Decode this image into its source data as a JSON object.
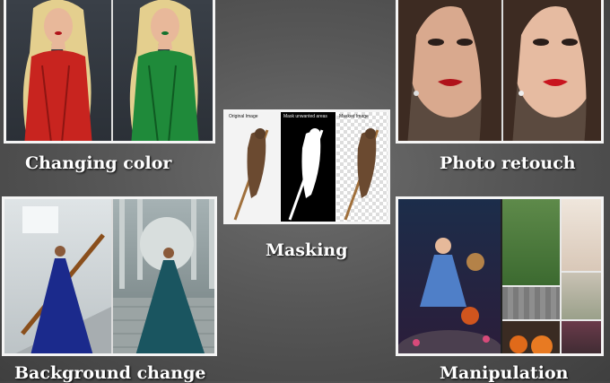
{
  "tiles": {
    "changing_color": {
      "caption": "Changing color"
    },
    "photo_retouch": {
      "caption": "Photo retouch"
    },
    "masking": {
      "caption": "Masking",
      "panels": [
        "Original Image",
        "Mask unwanted areas",
        "Masked Image"
      ]
    },
    "background_change": {
      "caption": "Background change"
    },
    "manipulation": {
      "caption": "Manipulation"
    }
  },
  "colors": {
    "dress_red": "#c8241f",
    "dress_green": "#1f8a3a",
    "gown_blue": "#1b2a8c",
    "gown_teal": "#1a5560",
    "frame": "#f4f4f4"
  }
}
